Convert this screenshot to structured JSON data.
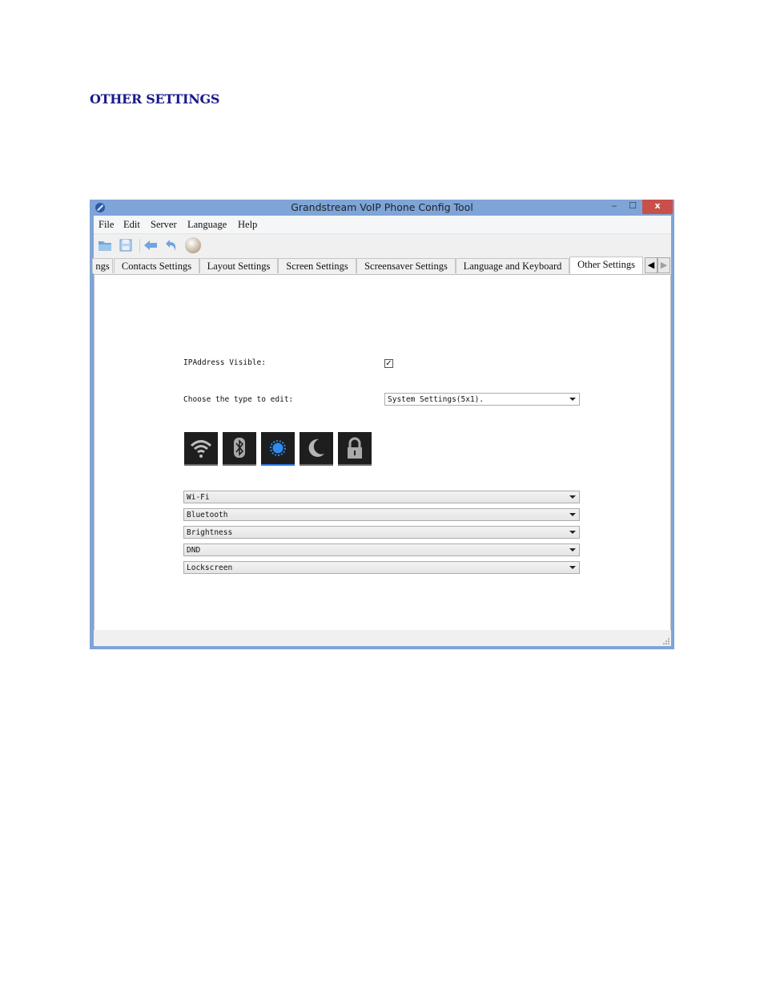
{
  "document": {
    "heading": "OTHER SETTINGS"
  },
  "window": {
    "title": "Grandstream VoIP Phone Config Tool",
    "controls": {
      "minimize": "‒",
      "maximize": "☐",
      "close": "x"
    }
  },
  "menubar": {
    "items": [
      "File",
      "Edit",
      "Server",
      "Language",
      "Help"
    ]
  },
  "toolbar": {
    "icons": [
      "open-folder-icon",
      "save-icon",
      "back-arrow-icon",
      "undo-icon",
      "sphere-icon"
    ]
  },
  "tabs": {
    "items": [
      {
        "label": "ngs",
        "active": false
      },
      {
        "label": "Contacts Settings",
        "active": false
      },
      {
        "label": "Layout Settings",
        "active": false
      },
      {
        "label": "Screen Settings",
        "active": false
      },
      {
        "label": "Screensaver Settings",
        "active": false
      },
      {
        "label": "Language and Keyboard",
        "active": false
      },
      {
        "label": "Other Settings",
        "active": true
      }
    ],
    "scroll_left": "◀",
    "scroll_right": "▶"
  },
  "settings": {
    "ip_visible": {
      "label": "IPAddress Visible:",
      "checked": true,
      "check_glyph": "✓"
    },
    "type": {
      "label": "Choose the type to edit:",
      "value": "System Settings(5x1)."
    },
    "icon_tiles": [
      {
        "name": "wifi",
        "selected": false
      },
      {
        "name": "bluetooth",
        "selected": false
      },
      {
        "name": "brightness",
        "selected": true
      },
      {
        "name": "dnd",
        "selected": false
      },
      {
        "name": "lockscreen",
        "selected": false
      }
    ],
    "slot_dropdowns": [
      "Wi-Fi",
      "Bluetooth",
      "Brightness",
      "DND",
      "Lockscreen"
    ]
  },
  "colors": {
    "heading": "#1a1a8c",
    "titlebar": "#7ea4d8",
    "close": "#c9504a",
    "selected_accent": "#2a7be4",
    "brightness_icon": "#2f8bf0"
  }
}
